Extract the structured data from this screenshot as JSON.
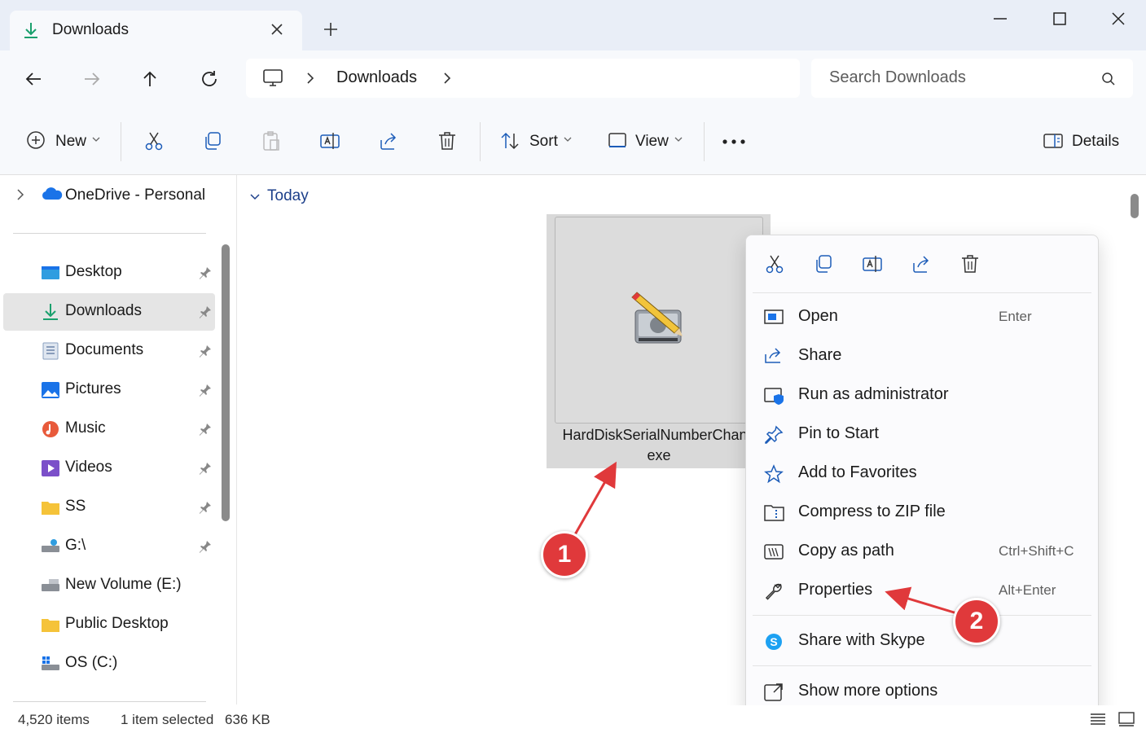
{
  "window": {
    "tab_title": "Downloads",
    "new_tab_label": "+"
  },
  "address_bar": {
    "location": "Downloads",
    "search_placeholder": "Search Downloads"
  },
  "toolbar": {
    "new_label": "New",
    "sort_label": "Sort",
    "view_label": "View",
    "more_label": "•••",
    "details_label": "Details"
  },
  "sidebar": {
    "onedrive": "OneDrive - Personal",
    "items": [
      {
        "label": "Desktop",
        "icon": "desktop-icon",
        "pinned": true
      },
      {
        "label": "Downloads",
        "icon": "downloads-icon",
        "pinned": true,
        "selected": true
      },
      {
        "label": "Documents",
        "icon": "documents-icon",
        "pinned": true
      },
      {
        "label": "Pictures",
        "icon": "pictures-icon",
        "pinned": true
      },
      {
        "label": "Music",
        "icon": "music-icon",
        "pinned": true
      },
      {
        "label": "Videos",
        "icon": "videos-icon",
        "pinned": true
      },
      {
        "label": "SS",
        "icon": "folder-icon",
        "pinned": true
      },
      {
        "label": "G:\\",
        "icon": "network-drive-icon",
        "pinned": true
      },
      {
        "label": "New Volume (E:)",
        "icon": "drive-icon",
        "pinned": false
      },
      {
        "label": "Public Desktop",
        "icon": "folder-icon",
        "pinned": false
      },
      {
        "label": "OS (C:)",
        "icon": "windows-drive-icon",
        "pinned": false
      }
    ]
  },
  "main": {
    "group_label": "Today",
    "file": {
      "name_line1": "HardDiskSerialNumberChang",
      "name_line2": "exe"
    }
  },
  "context_menu": {
    "items": [
      {
        "label": "Open",
        "shortcut": "Enter",
        "icon": "open-icon"
      },
      {
        "label": "Share",
        "shortcut": "",
        "icon": "share-icon"
      },
      {
        "label": "Run as administrator",
        "shortcut": "",
        "icon": "shield-icon"
      },
      {
        "label": "Pin to Start",
        "shortcut": "",
        "icon": "pin-icon"
      },
      {
        "label": "Add to Favorites",
        "shortcut": "",
        "icon": "star-icon"
      },
      {
        "label": "Compress to ZIP file",
        "shortcut": "",
        "icon": "zip-icon"
      },
      {
        "label": "Copy as path",
        "shortcut": "Ctrl+Shift+C",
        "icon": "path-icon"
      },
      {
        "label": "Properties",
        "shortcut": "Alt+Enter",
        "icon": "wrench-icon"
      },
      {
        "label": "Share with Skype",
        "shortcut": "",
        "icon": "skype-icon"
      },
      {
        "label": "Show more options",
        "shortcut": "",
        "icon": "more-options-icon"
      }
    ]
  },
  "status": {
    "item_count": "4,520 items",
    "selection": "1 item selected",
    "size": "636 KB"
  },
  "annotations": {
    "step1": "1",
    "step2": "2"
  },
  "colors": {
    "accent": "#1a73e8",
    "annotation_red": "#e0393b",
    "title_bar": "#e9eef7"
  }
}
